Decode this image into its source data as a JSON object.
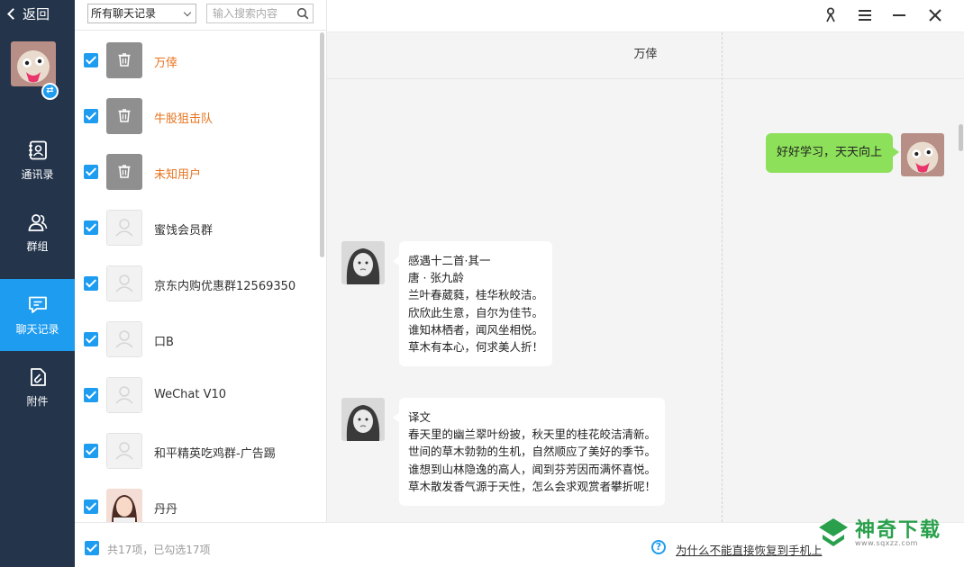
{
  "sidebar": {
    "back_label": "返回",
    "nav": [
      {
        "label": "通讯录",
        "icon": "contacts-icon"
      },
      {
        "label": "群组",
        "icon": "group-icon"
      },
      {
        "label": "聊天记录",
        "icon": "chat-record-icon",
        "active": true
      },
      {
        "label": "附件",
        "icon": "attachment-icon"
      }
    ]
  },
  "filter": {
    "selected": "所有聊天记录",
    "search_placeholder": "输入搜索内容"
  },
  "conversations": [
    {
      "name": "万倖",
      "avatar": "trash-icon",
      "name_color": "orange",
      "checked": true
    },
    {
      "name": "牛股狙击队",
      "avatar": "trash-icon",
      "name_color": "orange",
      "checked": true
    },
    {
      "name": "未知用户",
      "avatar": "trash-icon",
      "name_color": "orange",
      "checked": true
    },
    {
      "name": "蜜饯会员群",
      "avatar": "default-avatar-icon",
      "checked": true
    },
    {
      "name": "京东内购优惠群12569350",
      "avatar": "default-avatar-icon",
      "checked": true
    },
    {
      "name": "口B",
      "avatar": "default-avatar-icon",
      "checked": true
    },
    {
      "name": "WeChat V10",
      "avatar": "default-avatar-icon",
      "checked": true
    },
    {
      "name": "和平精英吃鸡群-广告踢",
      "avatar": "default-avatar-icon",
      "checked": true
    },
    {
      "name": "丹丹",
      "avatar": "photo-avatar",
      "checked": true
    }
  ],
  "list_footer": {
    "summary": "共17项，已勾选17项"
  },
  "chat": {
    "title": "万倖",
    "messages": [
      {
        "side": "right",
        "text": "好好学习，天天向上"
      },
      {
        "side": "left",
        "lines": [
          "感遇十二首·其一",
          "唐 · 张九龄",
          "兰叶春葳蕤，桂华秋皎洁。",
          "欣欣此生意，自尔为佳节。",
          "谁知林栖者，闻风坐相悦。",
          "草木有本心，何求美人折！"
        ]
      },
      {
        "side": "left",
        "lines": [
          "译文",
          "春天里的幽兰翠叶纷披，秋天里的桂花皎洁清新。",
          "世间的草木勃勃的生机，自然顺应了美好的季节。",
          "谁想到山林隐逸的高人，闻到芬芳因而满怀喜悦。",
          "草木散发香气源于天性，怎么会求观赏者攀折呢！"
        ]
      }
    ],
    "help_text": "为什么不能直接恢复到手机上"
  },
  "watermark": {
    "name": "神奇下载",
    "url": "www.sqxzz.com"
  },
  "colors": {
    "sidebar_bg": "#23344b",
    "accent": "#1e9cf0",
    "orange_name": "#e8731d",
    "bubble_green": "#8de05a"
  }
}
